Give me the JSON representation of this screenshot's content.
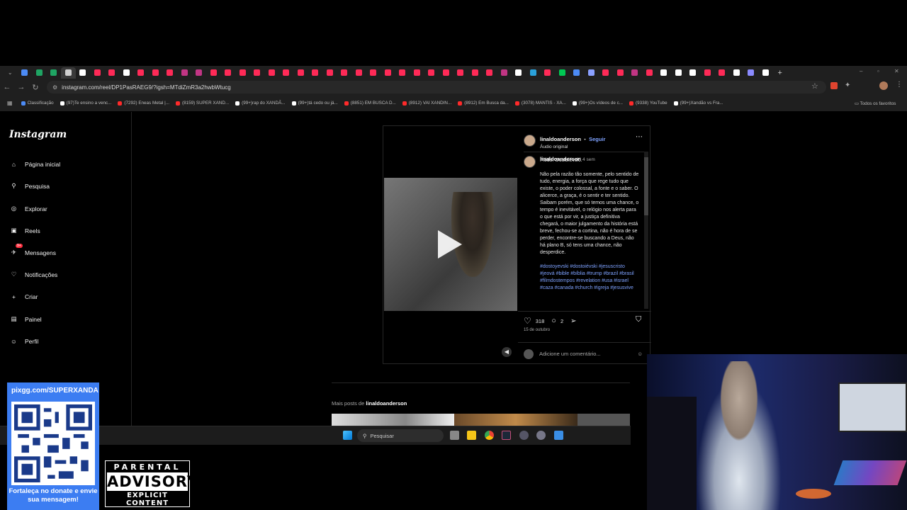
{
  "browser": {
    "url": "instagram.com/reel/DP1PasRAEG9/?igsh=MTdiZmR3a2hwbWtucg",
    "tab_colors": [
      "#4c8bf5",
      "#1fa463",
      "#1fa463",
      "#cfcfcf",
      "#ffffff",
      "#ff2a57",
      "#ff2a57",
      "#ffffff",
      "#ff2a57",
      "#ff2a57",
      "#ff2a57",
      "#c13584",
      "#c13584",
      "#ff2a57",
      "#ff2a57",
      "#ff2a57",
      "#ff2a57",
      "#ff2a57",
      "#ff2a57",
      "#ff2a57",
      "#ff2a57",
      "#ff2a57",
      "#ff2a57",
      "#ff2a57",
      "#ff2a57",
      "#ff2a57",
      "#ff2a57",
      "#ff2a57",
      "#ff2a57",
      "#ff2a57",
      "#ff2a57",
      "#ff2a57",
      "#ff2a57",
      "#c13584",
      "#ffffff",
      "#2aa1da",
      "#ff2a57",
      "#00c853",
      "#4c8bf5",
      "#8aa0ff",
      "#ff2a57",
      "#ff2a57",
      "#c13584",
      "#ff2a57",
      "#ffffff",
      "#ffffff",
      "#ffffff",
      "#ff2a57",
      "#ff2a57",
      "#ffffff",
      "#8a8aff",
      "#ffffff"
    ],
    "bookmarks": [
      {
        "label": "Classificação",
        "color": "#4c8bf5"
      },
      {
        "label": "(97)Te ensino a venc...",
        "color": "#ffffff"
      },
      {
        "label": "(7292) Eneas Metal |...",
        "color": "#ff2a2a"
      },
      {
        "label": "(8159) SUPER XAND...",
        "color": "#ff2a2a"
      },
      {
        "label": "(99+)rap do XANDÃ...",
        "color": "#ffffff"
      },
      {
        "label": "(99+)tá cedo ou já...",
        "color": "#ffffff"
      },
      {
        "label": "(8851) EM BUSCA D...",
        "color": "#ff2a2a"
      },
      {
        "label": "(8912) VAI XANDIN...",
        "color": "#ff2a2a"
      },
      {
        "label": "(8912) Em Busca da...",
        "color": "#ff2a2a"
      },
      {
        "label": "(3078) MANTIS - XA...",
        "color": "#ff2a2a"
      },
      {
        "label": "(99+)Os vídeos de c...",
        "color": "#ffffff"
      },
      {
        "label": "(9338) YouTube",
        "color": "#ff2a2a"
      },
      {
        "label": "(99+)Xandão vs Fra...",
        "color": "#ffffff"
      }
    ],
    "all_bookmarks": "Todos os favoritos"
  },
  "instagram": {
    "logo": "Instagram",
    "nav": [
      "Página inicial",
      "Pesquisa",
      "Explorar",
      "Reels",
      "Mensagens",
      "Notificações",
      "Criar",
      "Painel",
      "Perfil"
    ],
    "messages_badge": "9+",
    "post": {
      "username": "linaldoanderson",
      "dot": "•",
      "follow": "Seguir",
      "audio": "Áudio original",
      "time_ago": "4 sem",
      "caption_title": "Fiódor Dostoiévski.",
      "caption_body": "Não pela razão tão somente, pelo sentido de tudo, energia, a força que rege tudo que existe, o poder colossal, a fonte e o saber. O alicerce, a graça, é o sentir e ter sentido. Saibam porém, que só temos uma chance, o tempo é inevitável, o relógio nos alerta para o que está por vir, a justiça definitiva chegará, o maior julgamento da história está breve, fechou-se a cortina, não é hora de se perder, encontre-se buscando a Deus, não há plano B, só tens uma chance, não desperdice.",
      "hashtags": "#dostoyevski #dostoiévski #jesuscristo #jeová #bible #bíblia #trump #brazil #brasil⁠ #filmdostempos #revelation #usa #israel #caza #canada #church #igreja #jesusvive #yeshua #2025",
      "likes": "318",
      "comments": "2",
      "date": "15 de outubro",
      "comment_placeholder": "Adicione um comentário..."
    },
    "more_posts_prefix": "Mais posts de",
    "more_posts_user": "linaldoanderson"
  },
  "taskbar": {
    "search": "Pesquisar"
  },
  "overlay": {
    "qr_url": "pixgg.com/SUPERXANDA",
    "qr_message": "Fortaleça no donate e envie sua mensagem!",
    "advisory_top": "PARENTAL",
    "advisory_mid": "ADVISORY",
    "advisory_bottom": "EXPLICIT CONTENT"
  }
}
